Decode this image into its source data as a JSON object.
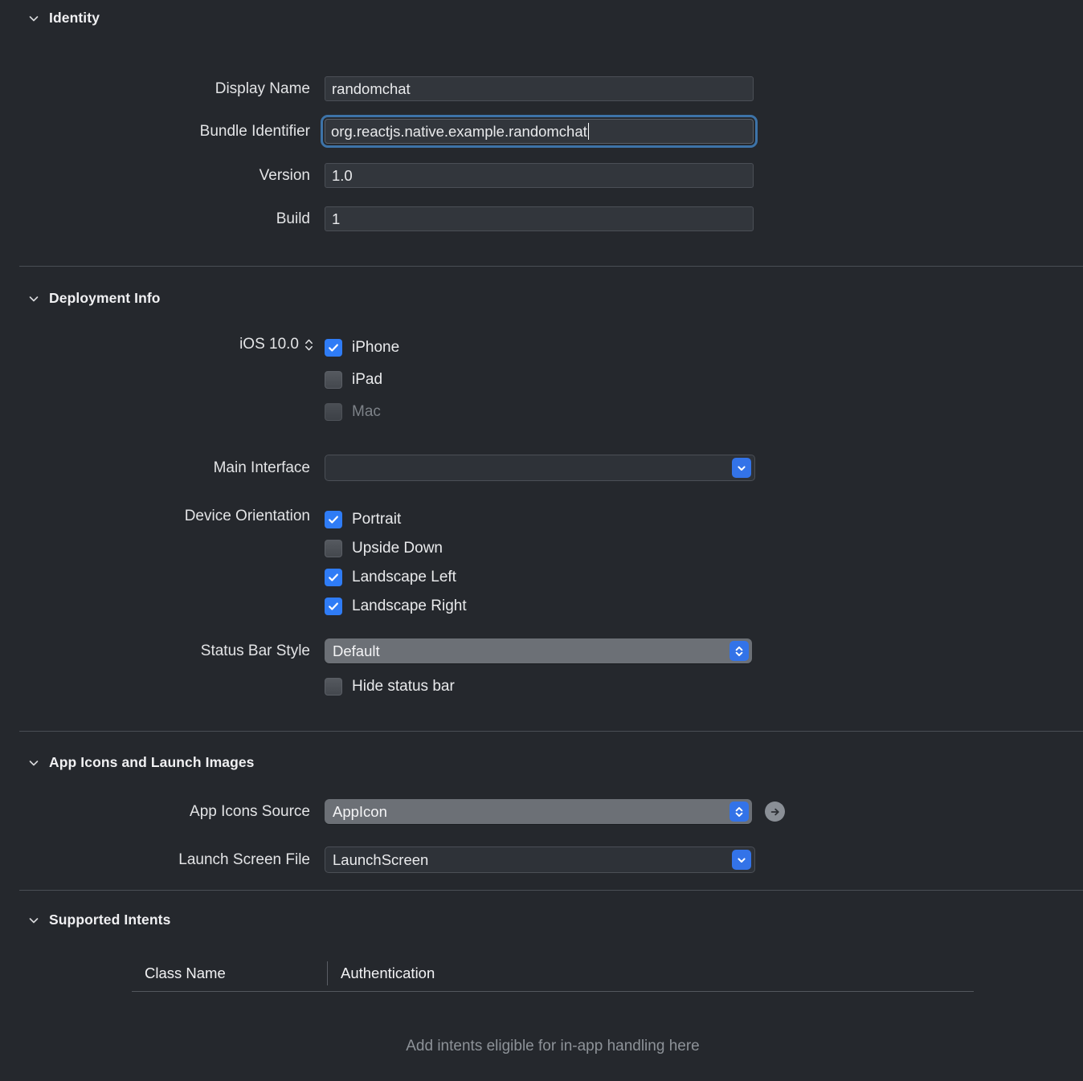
{
  "sections": {
    "identity": {
      "title": "Identity",
      "fields": {
        "display_name": {
          "label": "Display Name",
          "value": "randomchat"
        },
        "bundle_identifier": {
          "label": "Bundle Identifier",
          "value": "org.reactjs.native.example.randomchat"
        },
        "version": {
          "label": "Version",
          "value": "1.0"
        },
        "build": {
          "label": "Build",
          "value": "1"
        }
      }
    },
    "deployment_info": {
      "title": "Deployment Info",
      "deployment_target": {
        "value": "iOS 10.0"
      },
      "targets": [
        {
          "label": "iPhone",
          "checked": true,
          "disabled": false
        },
        {
          "label": "iPad",
          "checked": false,
          "disabled": false
        },
        {
          "label": "Mac",
          "checked": false,
          "disabled": true
        }
      ],
      "main_interface": {
        "label": "Main Interface",
        "value": ""
      },
      "device_orientation": {
        "label": "Device Orientation",
        "options": [
          {
            "label": "Portrait",
            "checked": true
          },
          {
            "label": "Upside Down",
            "checked": false
          },
          {
            "label": "Landscape Left",
            "checked": true
          },
          {
            "label": "Landscape Right",
            "checked": true
          }
        ]
      },
      "status_bar_style": {
        "label": "Status Bar Style",
        "value": "Default"
      },
      "hide_status_bar": {
        "label": "Hide status bar",
        "checked": false
      }
    },
    "app_icons": {
      "title": "App Icons and Launch Images",
      "app_icons_source": {
        "label": "App Icons Source",
        "value": "AppIcon"
      },
      "launch_screen_file": {
        "label": "Launch Screen File",
        "value": "LaunchScreen"
      }
    },
    "supported_intents": {
      "title": "Supported Intents",
      "columns": [
        "Class Name",
        "Authentication"
      ],
      "empty_message": "Add intents eligible for in-app handling here"
    }
  },
  "icons": {
    "disclosure": "chevron-down-icon",
    "stepper": "up-down-chevron-icon",
    "combo_arrow": "chevron-down-icon",
    "goto_arrow": "arrow-right-icon"
  },
  "colors": {
    "background": "#25282d",
    "accent_blue": "#2f7cf6",
    "field_background": "#32363c",
    "focus_ring": "#3d73a8",
    "popup_background": "#6c7076",
    "divider": "#4a4e55",
    "placeholder_text": "#8d9298"
  }
}
